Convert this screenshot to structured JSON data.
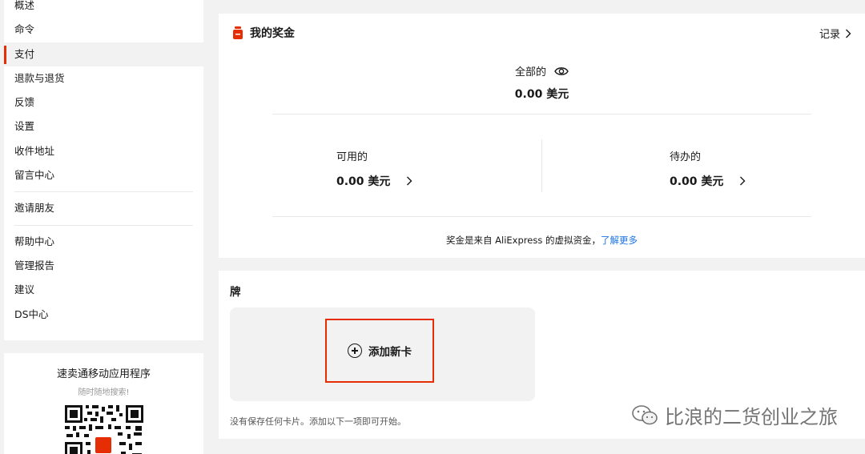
{
  "sidebar": {
    "items": [
      {
        "label": "概述"
      },
      {
        "label": "命令"
      },
      {
        "label": "支付",
        "active": true
      },
      {
        "label": "退款与退货"
      },
      {
        "label": "反馈"
      },
      {
        "label": "设置"
      },
      {
        "label": "收件地址"
      },
      {
        "label": "留言中心"
      },
      {
        "label": "邀请朋友"
      },
      {
        "label": "帮助中心"
      },
      {
        "label": "管理报告"
      },
      {
        "label": "建议"
      },
      {
        "label": "DS中心"
      }
    ]
  },
  "app_promo": {
    "title": "速卖通移动应用程序",
    "subtitle": "随时随地搜索!"
  },
  "bonus": {
    "title": "我的奖金",
    "records_label": "记录",
    "total_label": "全部的",
    "total_value": "0.00 美元",
    "available_label": "可用的",
    "available_value": "0.00 美元",
    "pending_label": "待办的",
    "pending_value": "0.00 美元",
    "note_text": "奖金是来自 AliExpress 的虚拟资金，",
    "note_link": "了解更多"
  },
  "cards": {
    "title": "牌",
    "add_card_label": "添加新卡",
    "empty_note": "没有保存任何卡片。添加以下一项即可开始。"
  },
  "watermark": {
    "text": "比浪的二货创业之旅"
  },
  "colors": {
    "accent": "#e62e04",
    "link": "#1a73e8",
    "page_bg": "#f2f2f2"
  }
}
